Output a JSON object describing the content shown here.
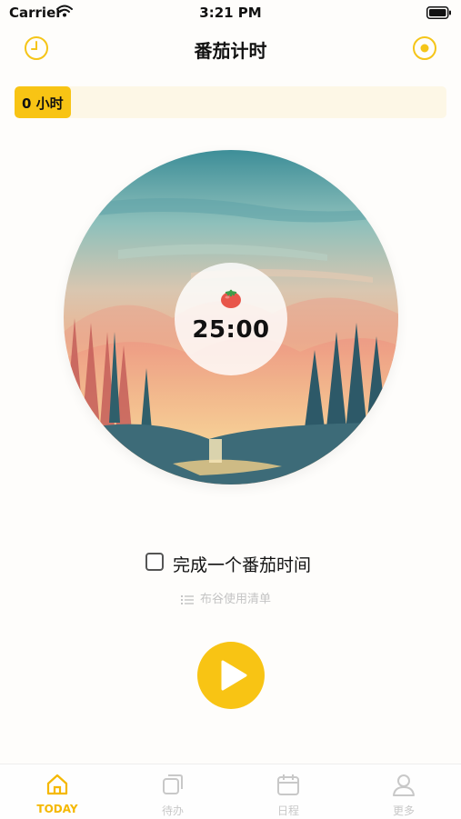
{
  "status_bar": {
    "carrier": "Carrier",
    "time": "3:21 PM",
    "icons": [
      "wifi-icon",
      "battery-icon"
    ]
  },
  "nav": {
    "title": "番茄计时",
    "left_icon": "clock-icon",
    "right_icon": "record-icon"
  },
  "progress": {
    "label": "0 小时",
    "fraction": 0.13
  },
  "timer": {
    "time": "25:00",
    "icon": "tomato-icon"
  },
  "task": {
    "checked": false,
    "label": "完成一个番茄时间"
  },
  "guide": {
    "text": "布谷使用清单",
    "icon": "list-icon"
  },
  "play": {
    "icon": "play-icon"
  },
  "tabs": [
    {
      "label": "TODAY",
      "icon": "home-icon",
      "active": true
    },
    {
      "label": "待办",
      "icon": "todo-icon",
      "active": false
    },
    {
      "label": "日程",
      "icon": "calendar-icon",
      "active": false
    },
    {
      "label": "更多",
      "icon": "user-icon",
      "active": false
    }
  ],
  "colors": {
    "accent": "#f8c414",
    "progress_track": "#fdf7e6",
    "inactive_tab": "#c8c8c8"
  }
}
